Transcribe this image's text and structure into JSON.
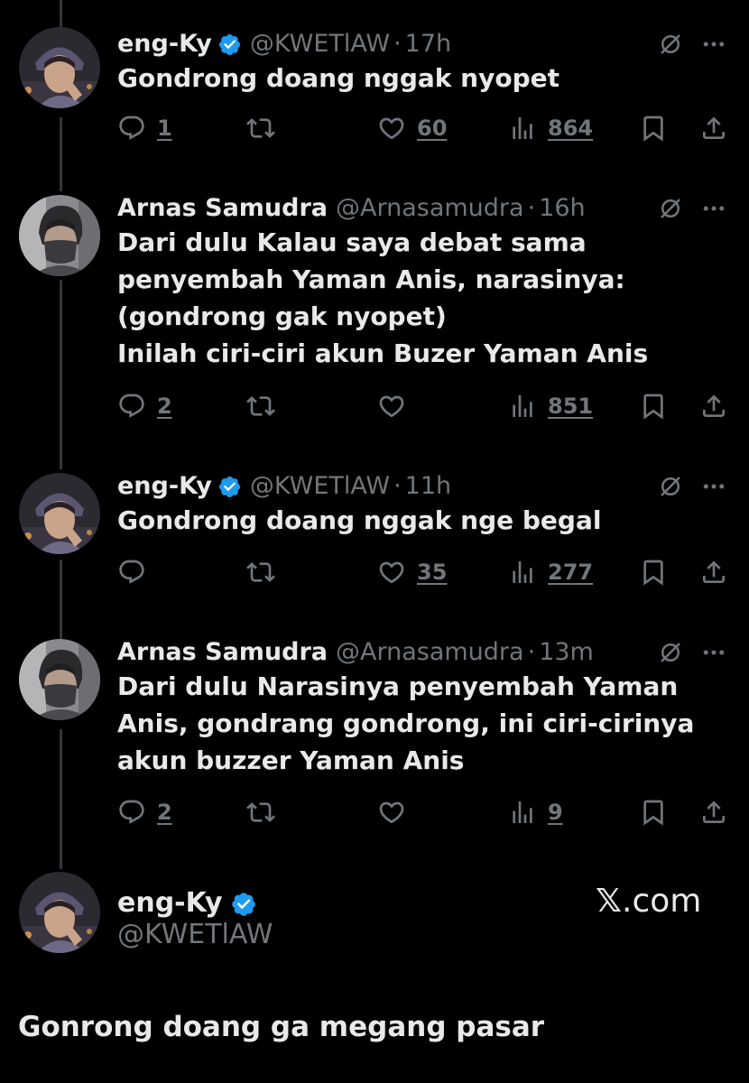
{
  "colors": {
    "background": "#000000",
    "primary_text": "#e7e9ea",
    "secondary_text": "#71767b",
    "verified_badge": "#1d9bf0"
  },
  "icons": {
    "reply": "speech-bubble-icon",
    "retweet": "retweet-icon",
    "like": "heart-icon",
    "views": "bar-chart-icon",
    "bookmark": "bookmark-icon",
    "share": "share-icon",
    "grok": "slashed-circle-icon",
    "more": "more-dots-icon",
    "verified": "verified-badge-icon"
  },
  "tweets": [
    {
      "name": "eng-Ky",
      "verified": true,
      "handle": "@KWETlAW",
      "separator": "·",
      "time": "17h",
      "text": "Gondrong doang nggak nyopet",
      "replies": "1",
      "retweets": "",
      "likes": "60",
      "views": "864"
    },
    {
      "name": "Arnas Samudra",
      "verified": false,
      "handle": "@Arnasamudra",
      "separator": "·",
      "time": "16h",
      "text": "Dari dulu Kalau saya debat sama\npenyembah Yaman Anis, narasinya:\n(gondrong gak nyopet)\nInilah ciri-ciri akun Buzer Yaman Anis",
      "replies": "2",
      "retweets": "",
      "likes": "",
      "views": "851"
    },
    {
      "name": "eng-Ky",
      "verified": true,
      "handle": "@KWETlAW",
      "separator": "·",
      "time": "11h",
      "text": "Gondrong doang nggak nge begal",
      "replies": "",
      "retweets": "",
      "likes": "35",
      "views": "277"
    },
    {
      "name": "Arnas Samudra",
      "verified": false,
      "handle": "@Arnasamudra",
      "separator": "·",
      "time": "13m",
      "text": "Dari dulu Narasinya penyembah Yaman\nAnis, gondrang gondrong, ini ciri-cirinya\nakun buzzer Yaman Anis",
      "replies": "2",
      "retweets": "",
      "likes": "",
      "views": "9"
    }
  ],
  "final_tweet": {
    "name": "eng-Ky",
    "verified": true,
    "handle": "@KWETlAW",
    "source_mark": "𝕏",
    "source_domain": ".com",
    "text": "Gonrong doang ga megang pasar"
  }
}
